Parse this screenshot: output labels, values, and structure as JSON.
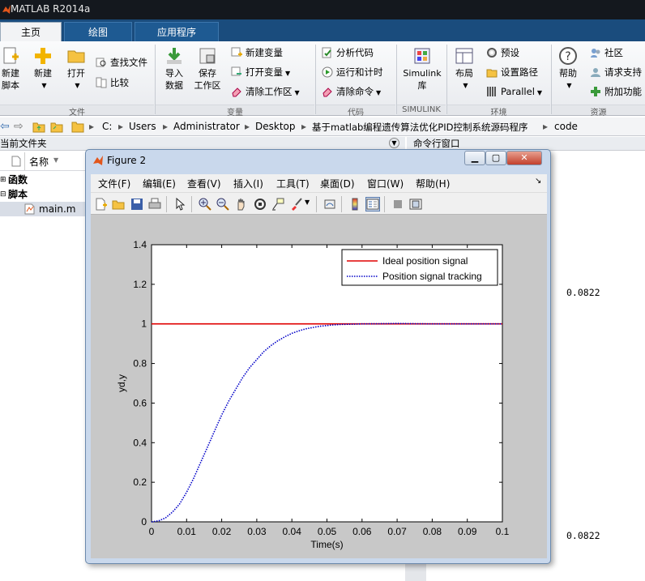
{
  "app": {
    "title": "MATLAB R2014a"
  },
  "tabs": [
    {
      "label": "主页"
    },
    {
      "label": "绘图"
    },
    {
      "label": "应用程序"
    }
  ],
  "ribbon": {
    "file": {
      "new_script": "新建\n脚本",
      "new": "新建",
      "open": "打开",
      "find_files": "查找文件",
      "compare": "比较",
      "group": "文件"
    },
    "variable": {
      "import": "导入\n数据",
      "save": "保存\n工作区",
      "new_var": "新建变量",
      "open_var": "打开变量",
      "clear_ws": "清除工作区",
      "group": "变量"
    },
    "code": {
      "analyze": "分析代码",
      "run_time": "运行和计时",
      "clear_cmd": "清除命令",
      "group": "代码"
    },
    "simulink": {
      "lib": "Simulink\n库",
      "group": "SIMULINK"
    },
    "env": {
      "layout": "布局",
      "prefs": "预设",
      "set_path": "设置路径",
      "parallel": "Parallel",
      "group": "环境"
    },
    "resources": {
      "help": "帮助",
      "community": "社区",
      "support": "请求支持",
      "addons": "附加功能",
      "group": "资源"
    }
  },
  "address": {
    "parts": [
      "C:",
      "Users",
      "Administrator",
      "Desktop",
      "基于matlab编程遗传算法优化PID控制系统源码程序",
      "code"
    ]
  },
  "panels": {
    "current_folder": "当前文件夹",
    "command_window": "命令行窗口",
    "name_col": "名称"
  },
  "files": [
    {
      "label": "函数"
    },
    {
      "label": "脚本"
    },
    {
      "label": "main.m"
    }
  ],
  "command_window": {
    "values": [
      "0.0822",
      "0.0822"
    ]
  },
  "figure": {
    "title": "Figure 2",
    "menu": [
      "文件(F)",
      "编辑(E)",
      "查看(V)",
      "插入(I)",
      "工具(T)",
      "桌面(D)",
      "窗口(W)",
      "帮助(H)"
    ],
    "icons": [
      "new-figure-icon",
      "open-icon",
      "save-icon",
      "print-icon",
      "pointer-icon",
      "zoom-in-icon",
      "zoom-out-icon",
      "pan-icon",
      "rotate-icon",
      "data-cursor-icon",
      "brush-icon",
      "link-icon",
      "colorbar-icon",
      "legend-icon",
      "hide-plot-tools-icon",
      "show-plot-tools-icon"
    ]
  },
  "chart_data": {
    "type": "line",
    "title": "",
    "xlabel": "Time(s)",
    "ylabel": "yd,y",
    "xlim": [
      0,
      0.1
    ],
    "ylim": [
      0,
      1.4
    ],
    "xticks": [
      0,
      0.01,
      0.02,
      0.03,
      0.04,
      0.05,
      0.06,
      0.07,
      0.08,
      0.09,
      0.1
    ],
    "yticks": [
      0,
      0.2,
      0.4,
      0.6,
      0.8,
      1,
      1.2,
      1.4
    ],
    "legend_position": "top-right",
    "series": [
      {
        "name": "Ideal position signal",
        "color": "#e00000",
        "style": "solid",
        "x": [
          0,
          0.1
        ],
        "y": [
          1,
          1
        ]
      },
      {
        "name": "Position signal tracking",
        "color": "#0000c8",
        "style": "dotted",
        "x": [
          0,
          0.002,
          0.004,
          0.006,
          0.008,
          0.01,
          0.012,
          0.014,
          0.016,
          0.018,
          0.02,
          0.022,
          0.024,
          0.026,
          0.028,
          0.03,
          0.032,
          0.034,
          0.036,
          0.038,
          0.04,
          0.042,
          0.044,
          0.046,
          0.048,
          0.05,
          0.052,
          0.054,
          0.056,
          0.058,
          0.06,
          0.065,
          0.07,
          0.075,
          0.08,
          0.085,
          0.09,
          0.095,
          0.1
        ],
        "y": [
          0,
          0.005,
          0.02,
          0.05,
          0.09,
          0.15,
          0.22,
          0.3,
          0.38,
          0.46,
          0.54,
          0.61,
          0.67,
          0.73,
          0.78,
          0.82,
          0.86,
          0.89,
          0.915,
          0.935,
          0.952,
          0.965,
          0.975,
          0.982,
          0.988,
          0.992,
          0.995,
          0.997,
          0.998,
          0.999,
          1.0,
          1.001,
          1.002,
          1.001,
          1.0,
          1.0,
          1.0,
          1.0,
          1.0
        ]
      }
    ]
  }
}
